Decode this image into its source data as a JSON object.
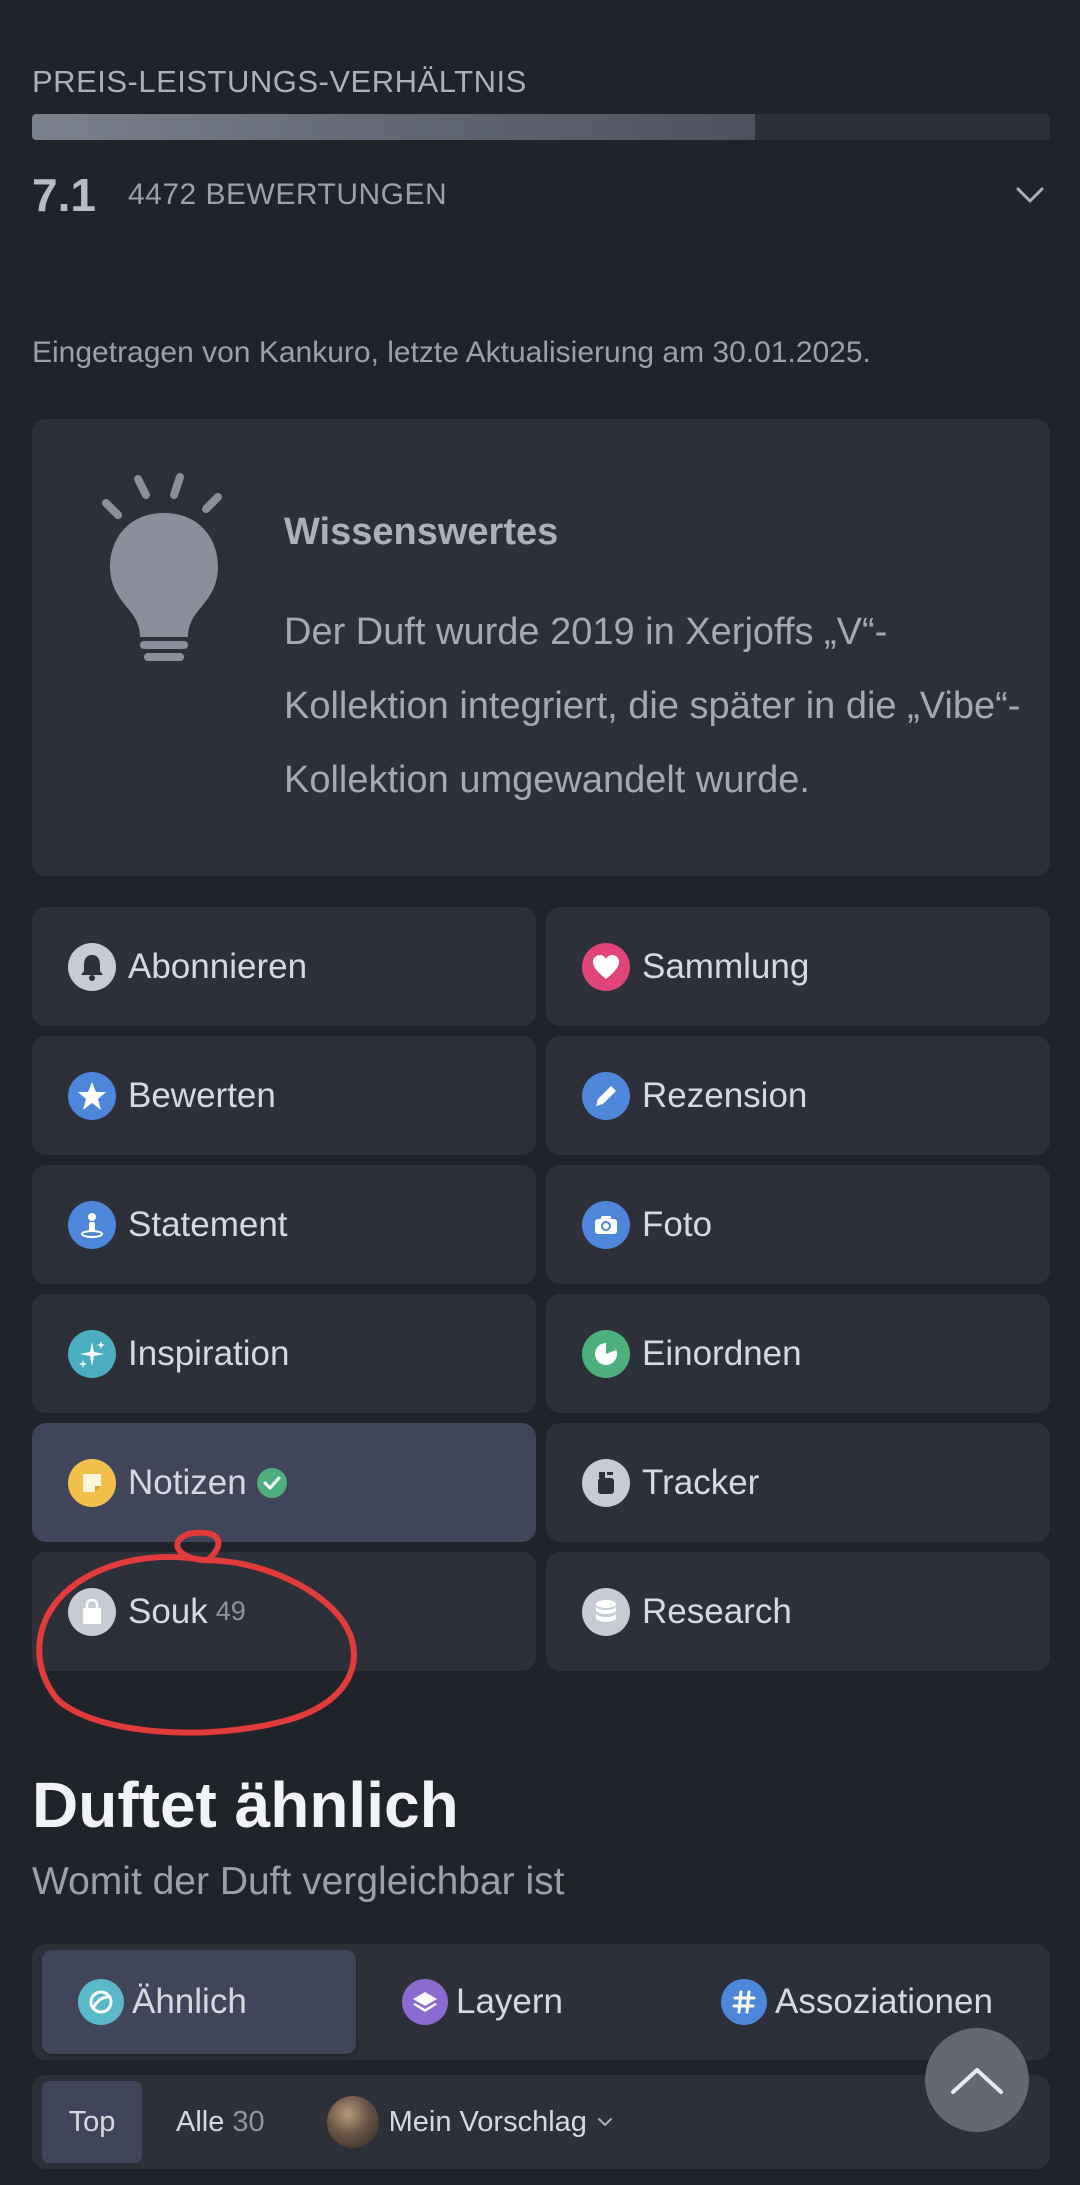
{
  "rating": {
    "label": "PREIS-LEISTUNGS-VERHÄLTNIS",
    "fill_fraction": 0.71,
    "score": "7.1",
    "count_text": "4472 BEWERTUNGEN"
  },
  "meta_text": "Eingetragen von Kankuro, letzte Aktualisierung am 30.01.2025.",
  "info": {
    "title": "Wissenswertes",
    "text": "Der Duft wurde 2019 in Xerjoffs „V“-Kollektion integriert, die später in die „Vibe“-Kollektion umgewandelt wurde."
  },
  "actions": [
    {
      "label": "Abonnieren",
      "icon": "bell-icon",
      "color": "#c7cbd3"
    },
    {
      "label": "Sammlung",
      "icon": "heart-icon",
      "color": "#e0447a"
    },
    {
      "label": "Bewerten",
      "icon": "star-icon",
      "color": "#4e86d9"
    },
    {
      "label": "Rezension",
      "icon": "pencil-icon",
      "color": "#4e86d9"
    },
    {
      "label": "Statement",
      "icon": "person-icon",
      "color": "#4e86d9"
    },
    {
      "label": "Foto",
      "icon": "camera-icon",
      "color": "#4e86d9"
    },
    {
      "label": "Inspiration",
      "icon": "sparkles-icon",
      "color": "#4aaec0"
    },
    {
      "label": "Einordnen",
      "icon": "pie-icon",
      "color": "#4caf7d"
    },
    {
      "label": "Notizen",
      "icon": "note-icon",
      "color": "#f1c04a"
    },
    {
      "label": "Tracker",
      "icon": "bottle-icon",
      "color": "#c7cbd3"
    },
    {
      "label": "Souk",
      "count": "49",
      "icon": "bag-icon",
      "color": "#c7cbd3"
    },
    {
      "label": "Research",
      "icon": "database-icon",
      "color": "#c7cbd3"
    }
  ],
  "similar": {
    "title": "Duftet ähnlich",
    "subtitle": "Womit der Duft vergleichbar ist",
    "tabs": [
      {
        "label": "Ähnlich",
        "icon": "swirl-icon",
        "color": "#5bb8c8"
      },
      {
        "label": "Layern",
        "icon": "layers-icon",
        "color": "#8c6bd0"
      },
      {
        "label": "Assoziationen",
        "icon": "hash-icon",
        "color": "#4e86d9"
      }
    ],
    "subtabs": {
      "top": "Top",
      "all": "Alle",
      "all_count": "30",
      "mine": "Mein Vorschlag"
    }
  }
}
